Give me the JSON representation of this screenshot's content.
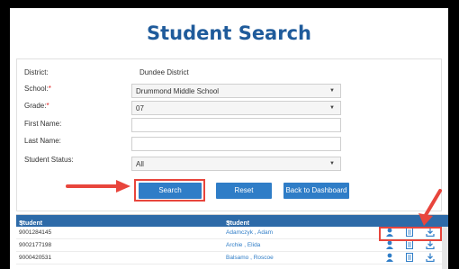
{
  "page": {
    "title": "Student Search"
  },
  "form": {
    "district_label": "District:",
    "district_value": "Dundee District",
    "school_label": "School:",
    "school_value": "Drummond Middle School",
    "grade_label": "Grade:",
    "grade_value": "07",
    "first_name_label": "First Name:",
    "first_name_value": "",
    "last_name_label": "Last Name:",
    "last_name_value": "",
    "status_label": "Student Status:",
    "status_value": "All",
    "required_mark": "*"
  },
  "buttons": {
    "search": "Search",
    "reset": "Reset",
    "back": "Back to Dashboard"
  },
  "grid": {
    "columns": [
      "Student GTID",
      "Student Name"
    ],
    "sort_glyph": "⊤",
    "rows": [
      {
        "gtid": "9001284145",
        "name": "Adamczyk , Adam"
      },
      {
        "gtid": "9002177198",
        "name": "Archie , Elida"
      },
      {
        "gtid": "9000420531",
        "name": "Balsamo , Roscoe"
      }
    ]
  },
  "colors": {
    "accent": "#2f7dc7",
    "header": "#2d6aa8",
    "highlight": "#e8453c",
    "title": "#1f5b9b"
  },
  "icons": [
    "person-icon",
    "document-icon",
    "download-icon"
  ]
}
